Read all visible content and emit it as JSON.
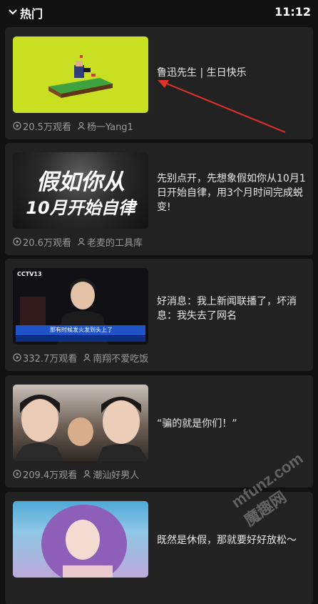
{
  "header": {
    "title": "热门",
    "time": "11:12"
  },
  "videos": [
    {
      "title": "鲁迅先生 | 生日快乐",
      "views": "20.5万观看",
      "author": "杨一Yang1"
    },
    {
      "title": "先别点开，先想象假如你从10月1日开始自律，用3个月时间完成蜕变!",
      "views": "20.6万观看",
      "author": "老麦的工具库",
      "thumb_line1": "假如你从",
      "thumb_line2": "10月开始自律"
    },
    {
      "title": "好消息：我上新闻联播了，坏消息：我失去了网名",
      "views": "332.7万观看",
      "author": "南翔不爱吃饭",
      "thumb_logo": "CCTV13",
      "thumb_banner": "那有时候发火发到头上了"
    },
    {
      "title": "“骗的就是你们！”",
      "views": "209.4万观看",
      "author": "潮汕好男人"
    },
    {
      "title": "既然是休假，那就要好好放松～",
      "views": "",
      "author": ""
    }
  ],
  "watermark": "mfunz.com 魔趣网",
  "colors": {
    "background": "#111111",
    "card": "#222222",
    "annotation_arrow": "#e0312b"
  }
}
